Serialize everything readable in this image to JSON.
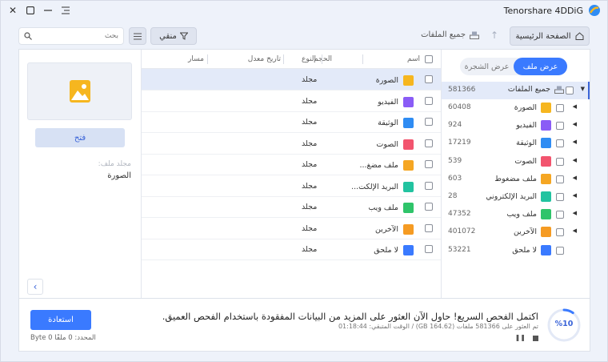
{
  "app": {
    "brand": "Tenorshare 4DDiG"
  },
  "toolbar": {
    "home_label": "الصفحة الرئيسية",
    "breadcrumb": "جميع الملفات",
    "filter_label": "منقي",
    "search_placeholder": "بحث"
  },
  "preview": {
    "open_label": "فتح",
    "folder_label": "مجلد ملف:",
    "folder_value": "الصورة"
  },
  "file_list": {
    "headers": {
      "name": "اسم",
      "size": "الحجم",
      "type": "النوع",
      "modified": "تاريخ معدل",
      "path": "مسار"
    },
    "rows": [
      {
        "name": "الصورة",
        "type": "مجلد",
        "icon": "image-icon",
        "color": "#f6b61f",
        "selected": true
      },
      {
        "name": "الفيديو",
        "type": "مجلد",
        "icon": "video-icon",
        "color": "#8a5cf6"
      },
      {
        "name": "الوثيقة",
        "type": "مجلد",
        "icon": "document-icon",
        "color": "#2f8cf3"
      },
      {
        "name": "الصوت",
        "type": "مجلد",
        "icon": "audio-icon",
        "color": "#f2546e"
      },
      {
        "name": "ملف مضغ...",
        "type": "مجلد",
        "icon": "archive-icon",
        "color": "#f5a623"
      },
      {
        "name": "البريد الإلكت...",
        "type": "مجلد",
        "icon": "email-icon",
        "color": "#22c3a0"
      },
      {
        "name": "ملف ويب",
        "type": "مجلد",
        "icon": "web-icon",
        "color": "#2fc46a"
      },
      {
        "name": "الآخرين",
        "type": "مجلد",
        "icon": "others-icon",
        "color": "#f59b23"
      },
      {
        "name": "لا ملحق",
        "type": "مجلد",
        "icon": "unknown-icon",
        "color": "#3a7aff"
      }
    ]
  },
  "tree": {
    "tab_file_view": "عرض ملف",
    "tab_tree_view": "عرض الشجرة",
    "root": {
      "label": "جميع الملفات",
      "count": "581366"
    },
    "nodes": [
      {
        "label": "الصورة",
        "count": "60408",
        "icon": "image-icon",
        "color": "#f6b61f"
      },
      {
        "label": "الفيديو",
        "count": "924",
        "icon": "video-icon",
        "color": "#8a5cf6"
      },
      {
        "label": "الوثيقة",
        "count": "17219",
        "icon": "document-icon",
        "color": "#2f8cf3"
      },
      {
        "label": "الصوت",
        "count": "539",
        "icon": "audio-icon",
        "color": "#f2546e"
      },
      {
        "label": "ملف مضغوط",
        "count": "603",
        "icon": "archive-icon",
        "color": "#f5a623"
      },
      {
        "label": "البريد الإلكتروني",
        "count": "28",
        "icon": "email-icon",
        "color": "#22c3a0"
      },
      {
        "label": "ملف ويب",
        "count": "47352",
        "icon": "web-icon",
        "color": "#2fc46a"
      },
      {
        "label": "الآخرين",
        "count": "401072",
        "icon": "others-icon",
        "color": "#f59b23"
      },
      {
        "label": "لا ملحق",
        "count": "53221",
        "icon": "unknown-icon",
        "color": "#3a7aff"
      }
    ]
  },
  "bottom": {
    "recover_label": "استعادة",
    "selected_info": "المحدد: 0 ملفًا 0 Byte",
    "progress": "%10",
    "progress_value": 10,
    "scan_title": "اكتمل الفحص السريع! حاول الآن العثور على المزيد من البيانات المفقودة باستخدام الفحص العميق.",
    "scan_sub": "تم العثور على 581366 ملفات (164.62 GB)  /  الوقت المتبقي: 01:18:44"
  },
  "colors": {
    "accent": "#3a7aff",
    "selection": "#e3eaf9"
  }
}
